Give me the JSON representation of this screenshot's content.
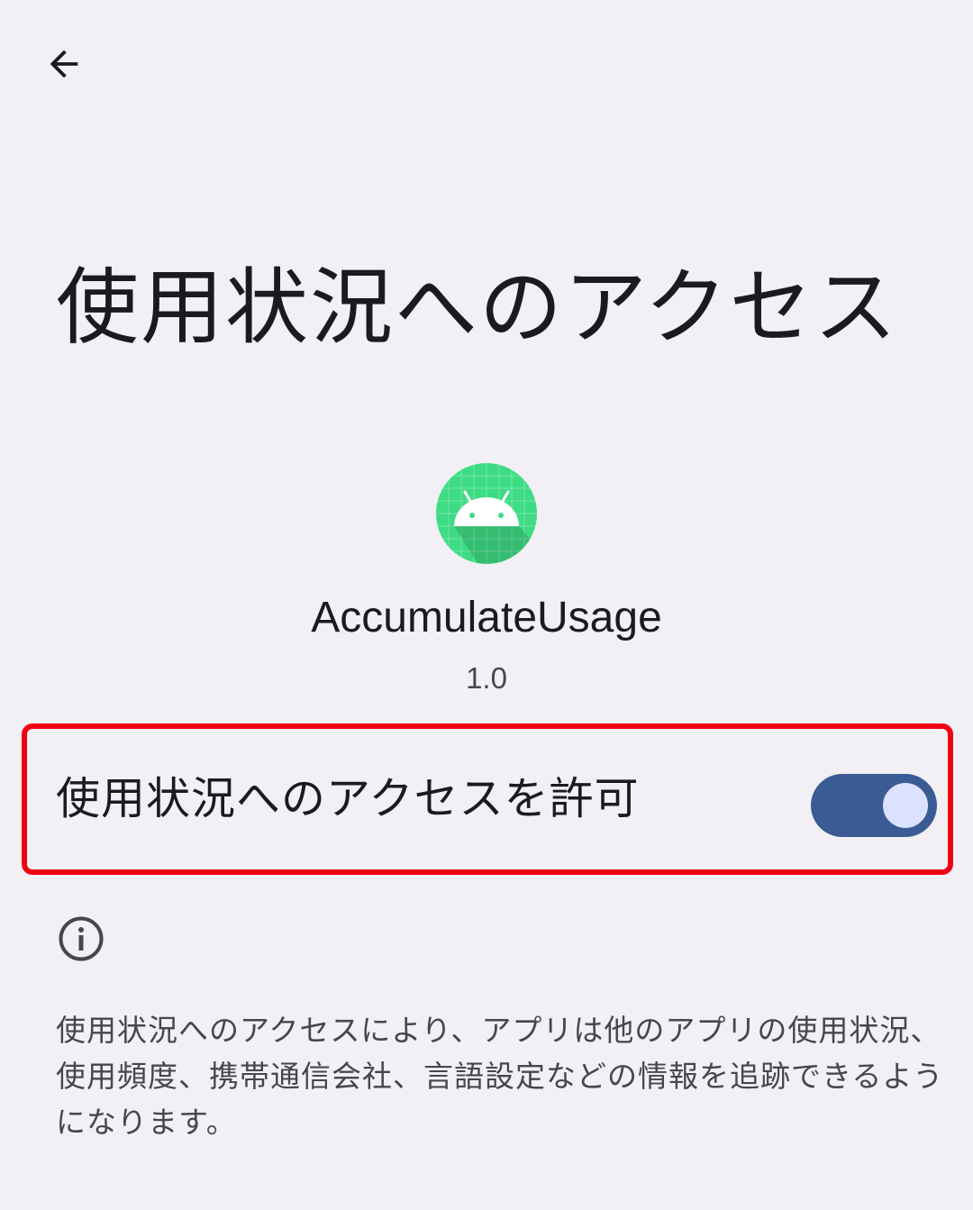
{
  "header": {
    "back_icon": "arrow-back-icon"
  },
  "page": {
    "title": "使用状況へのアクセス"
  },
  "app": {
    "icon": "android-app-icon",
    "name": "AccumulateUsage",
    "version": "1.0"
  },
  "permission": {
    "label": "使用状況へのアクセスを許可",
    "enabled": true
  },
  "info": {
    "icon": "info-icon",
    "description": "使用状況へのアクセスにより、アプリは他のアプリの使用状況、使用頻度、携帯通信会社、言語設定などの情報を追跡できるようになります。"
  },
  "colors": {
    "background": "#F2F0F4",
    "switch_track": "#3B5B95",
    "switch_thumb": "#DAE2FF",
    "highlight_border": "#F00014",
    "icon_green": "#3DDC84"
  }
}
